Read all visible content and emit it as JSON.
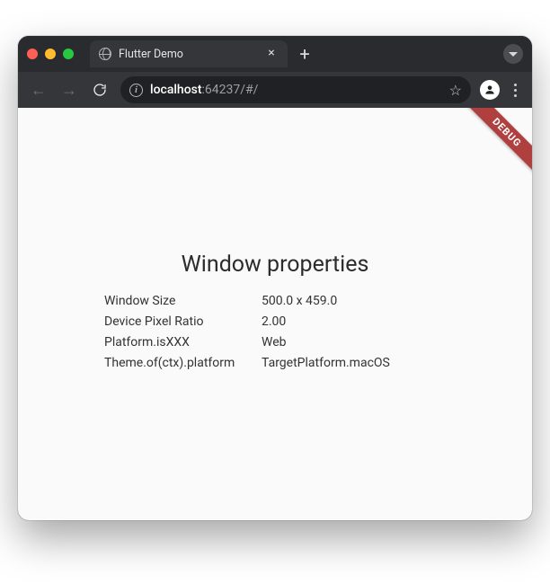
{
  "tab": {
    "title": "Flutter Demo"
  },
  "address": {
    "host": "localhost",
    "port_path": ":64237/#/"
  },
  "debug_banner": "DEBUG",
  "page": {
    "heading": "Window properties",
    "rows": [
      {
        "label": "Window Size",
        "value": "500.0 x 459.0"
      },
      {
        "label": "Device Pixel Ratio",
        "value": "2.00"
      },
      {
        "label": "Platform.isXXX",
        "value": "Web"
      },
      {
        "label": "Theme.of(ctx).platform",
        "value": "TargetPlatform.macOS"
      }
    ]
  }
}
